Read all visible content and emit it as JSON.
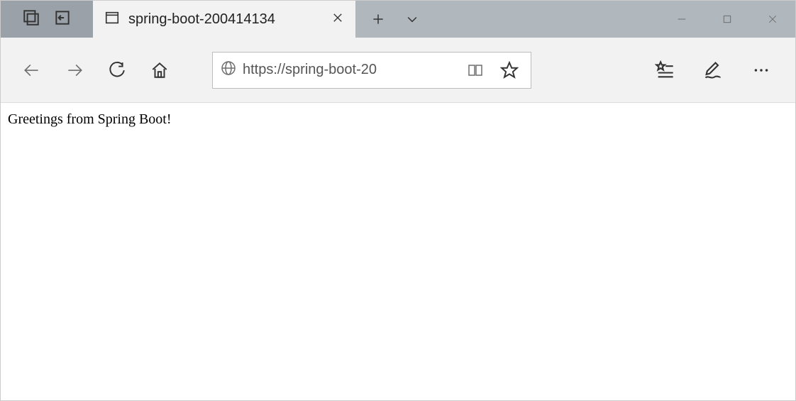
{
  "tab": {
    "title": "spring-boot-200414134"
  },
  "address": {
    "url": "https://spring-boot-20"
  },
  "page": {
    "body_text": "Greetings from Spring Boot!"
  }
}
